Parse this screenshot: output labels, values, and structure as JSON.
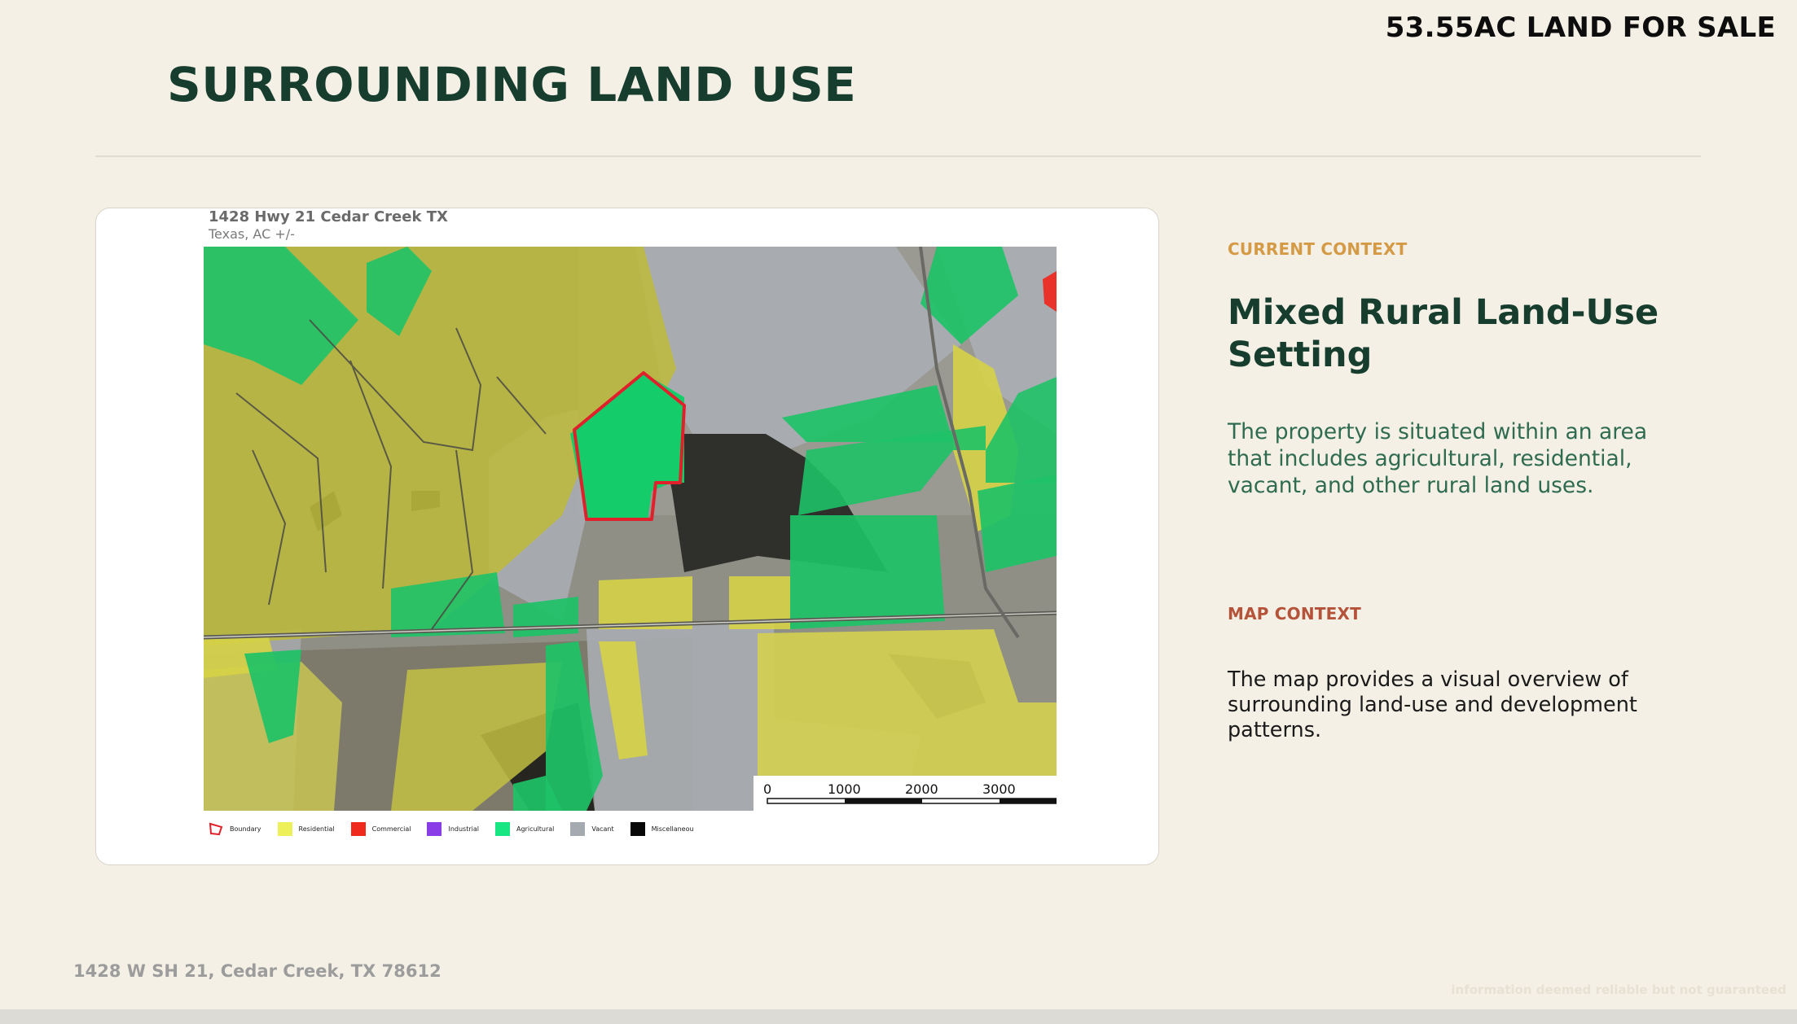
{
  "header": {
    "listing_title": "53.55AC LAND FOR SALE",
    "page_title": "SURROUNDING LAND USE"
  },
  "map": {
    "caption_title": "1428 Hwy 21 Cedar Creek TX",
    "caption_subtitle": "Texas,  AC +/-",
    "scale_bar": {
      "labels": [
        "0",
        "1000",
        "2000",
        "3000"
      ]
    },
    "legend": [
      {
        "label": "Boundary",
        "color": "#e0202a",
        "kind": "outline"
      },
      {
        "label": "Residential",
        "color": "#eef05a",
        "kind": "fill"
      },
      {
        "label": "Commercial",
        "color": "#ef2a1c",
        "kind": "fill"
      },
      {
        "label": "Industrial",
        "color": "#8a3de6",
        "kind": "fill"
      },
      {
        "label": "Agricultural",
        "color": "#18e683",
        "kind": "fill"
      },
      {
        "label": "Vacant",
        "color": "#a5aab0",
        "kind": "fill"
      },
      {
        "label": "Miscellaneou",
        "color": "#080808",
        "kind": "fill"
      }
    ]
  },
  "side_panel": {
    "current_context_label": "CURRENT CONTEXT",
    "current_context_color": "#d59a46",
    "heading": "Mixed Rural Land-Use Setting",
    "current_context_body": "The property is situated within an area that includes agricultural, residential, vacant, and other rural land uses.",
    "current_context_body_color": "#2e6b50",
    "map_context_label": "MAP CONTEXT",
    "map_context_color": "#b4523a",
    "map_context_body": "The map provides a visual overview of surrounding land-use and development patterns.",
    "map_context_body_color": "#1a1a1a"
  },
  "footer": {
    "address": "1428 W SH 21, Cedar Creek, TX 78612",
    "disclaimer": "information deemed reliable but not guaranteed"
  }
}
